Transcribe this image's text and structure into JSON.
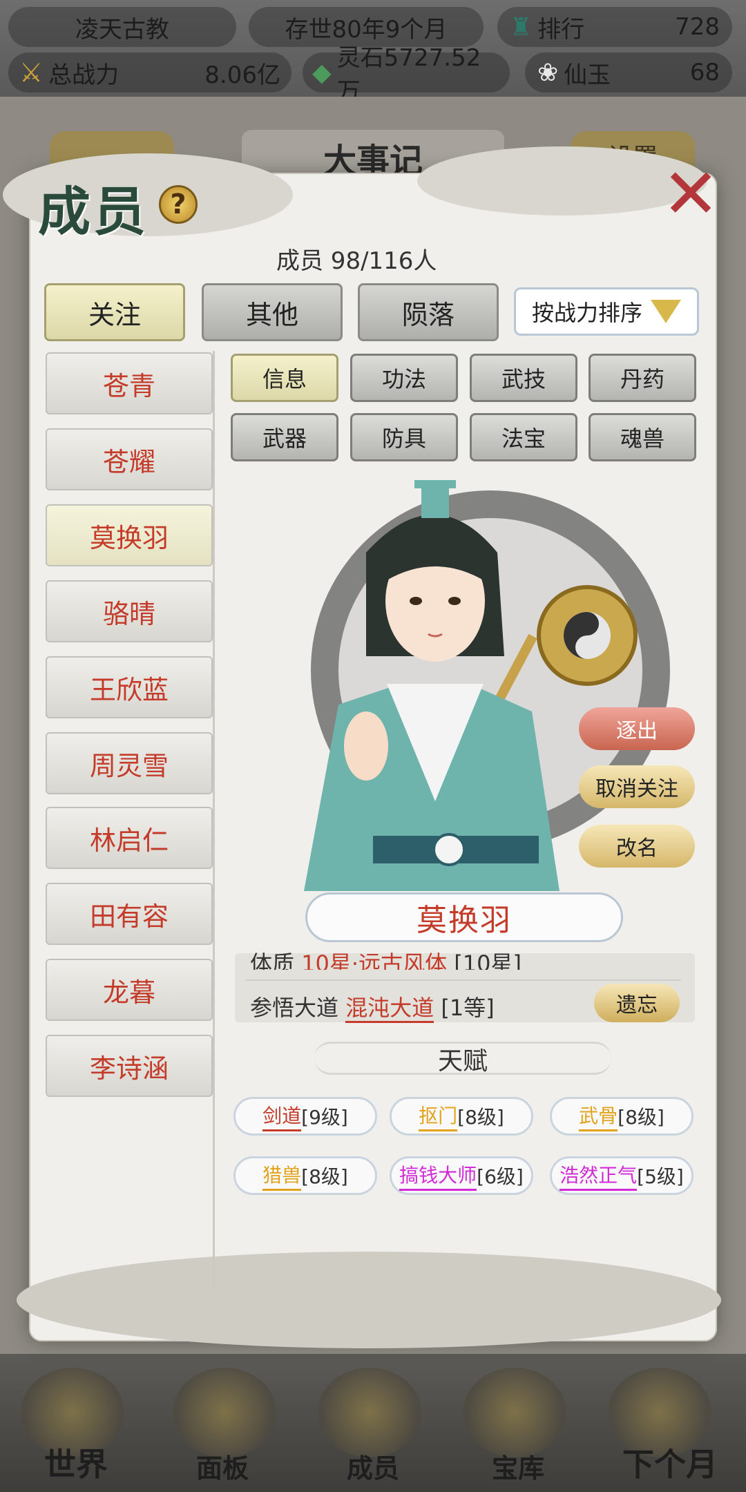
{
  "topbar": {
    "sect_name": "凌天古教",
    "existence": "存世80年9个月",
    "rank_label": "排行",
    "rank_value": "728",
    "power_label": "总战力",
    "power_value": "8.06亿",
    "spirit_stones": "灵石5727.52万",
    "jade_label": "仙玉",
    "jade_value": "68"
  },
  "background": {
    "events_title": "大事记",
    "settings_label": "设置"
  },
  "modal": {
    "title": "成员",
    "help_symbol": "?",
    "close_symbol": "✕",
    "member_count": "成员  98/116人",
    "tabs": [
      "关注",
      "其他",
      "陨落"
    ],
    "sort_label": "按战力排序",
    "members": [
      "苍青",
      "苍耀",
      "莫换羽",
      "骆晴",
      "王欣蓝",
      "周灵雪",
      "林启仁",
      "田有容",
      "龙暮",
      "李诗涵"
    ],
    "subtabs": [
      "信息",
      "功法",
      "武技",
      "丹药",
      "武器",
      "防具",
      "法宝",
      "魂兽"
    ],
    "actions": {
      "expel": "逐出",
      "unfollow": "取消关注",
      "rename": "改名"
    },
    "selected_name": "莫换羽",
    "info": {
      "physique_label": "体质",
      "physique_value": "10星·远古风体",
      "physique_level": "[10星]",
      "dao_label": "参悟大道",
      "dao_value": "混沌大道",
      "dao_level": "[1等]",
      "forget_label": "遗忘"
    },
    "talent_title": "天赋",
    "talents": [
      {
        "name": "剑道",
        "level": "[9级]"
      },
      {
        "name": "抠门",
        "level": "[8级]"
      },
      {
        "name": "武骨",
        "level": "[8级]"
      },
      {
        "name": "猎兽",
        "level": "[8级]"
      },
      {
        "name": "搞钱大师",
        "level": "[6级]"
      },
      {
        "name": "浩然正气",
        "level": "[5级]"
      }
    ]
  },
  "bottom_nav": [
    "世界",
    "面板",
    "成员",
    "宝库",
    "下个月"
  ],
  "colors": {
    "accent_red": "#c43b2a",
    "talent_orange": "#e2a21c",
    "talent_magenta": "#d12ad6",
    "active_tab": "#f4f1cc"
  }
}
